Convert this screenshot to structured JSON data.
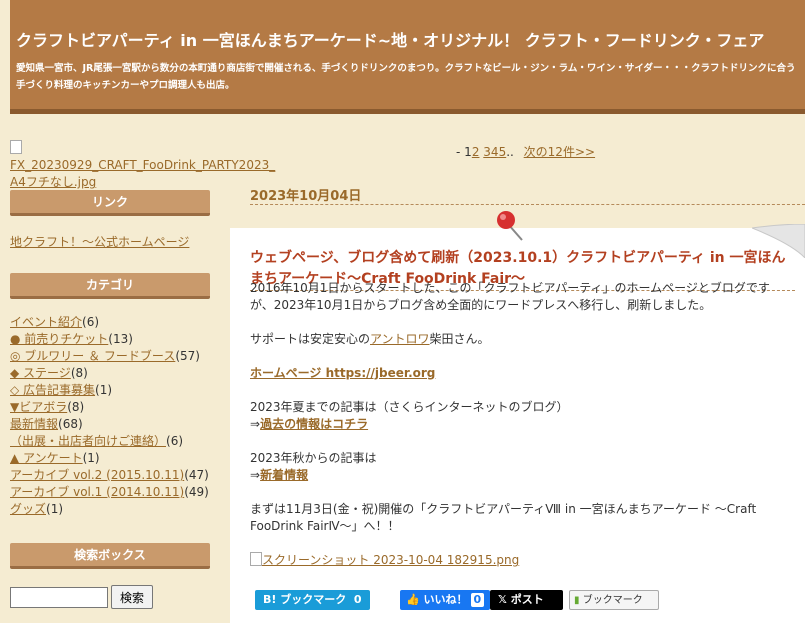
{
  "header": {
    "title": "クラフトビアパーティ in 一宮ほんまちアーケード~地・オリジナル！ クラフト・フードリンク・フェア",
    "description": "愛知県一宮市、JR尾張一宮駅から数分の本町通り商店街で開催される、手づくりドリンクのまつり。クラフトなビール・ジン・ラム・ワイン・サイダー・・・クラフトドリンクに合う手づくり料理のキッチンカーやプロ調理人も出店。"
  },
  "banner": {
    "alt": "FX_20230929_CRAFT_FooDrink_PARTY2023_A4フチなし.jpg"
  },
  "sidebar": {
    "links_heading": "リンク",
    "link_official": "地クラフト！～公式ホームページ",
    "categories_heading": "カテゴリ",
    "categories": [
      {
        "label": "イベント紹介",
        "count": "(6)"
      },
      {
        "label": "● 前売りチケット",
        "count": "(13)"
      },
      {
        "label": "◎ ブルワリー ＆ フードブース",
        "count": "(57)"
      },
      {
        "label": "◆ ステージ",
        "count": "(8)"
      },
      {
        "label": "◇ 広告記事募集",
        "count": "(1)"
      },
      {
        "label": "▼ビアボラ",
        "count": "(8)"
      },
      {
        "label": "最新情報",
        "count": "(68)"
      },
      {
        "label": "（出展・出店者向けご連絡）",
        "count": "(6)"
      },
      {
        "label": "▲ アンケート",
        "count": "(1)"
      },
      {
        "label": "アーカイブ vol.2 (2015.10.11)",
        "count": "(47)"
      },
      {
        "label": "アーカイブ vol.1 (2014.10.11)",
        "count": "(49)"
      },
      {
        "label": "グッズ",
        "count": "(1)"
      }
    ],
    "search_heading": "検索ボックス",
    "search_value": "",
    "search_button": "検索"
  },
  "pager": {
    "prefix": "-",
    "current": "1",
    "pages": [
      "2",
      "3",
      "4",
      "5"
    ],
    "ellipsis": "..",
    "next": "次の12件>>"
  },
  "post": {
    "date": "2023年10月04日",
    "title": "ウェブページ、ブログ含めて刷新（2023.10.1）クラフトビアパーティ in 一宮ほんまちアーケード～Craft FooDrink Fair～",
    "para1": "2016年10月1日からスタートした、この「クラフトビアパーティ」のホームページとブログですが、2023年10月1日からブログ含め全面的にワードプレスへ移行し、刷新しました。",
    "support_prefix": "サポートは安定安心の",
    "support_link": "アントロワ",
    "support_suffix": "柴田さん。",
    "homepage": "ホームページ https://jbeer.org",
    "old_text": "2023年夏までの記事は（さくらインターネットのブログ）",
    "old_arrow": "⇒",
    "old_link": "過去の情報はコチラ",
    "new_text": "2023年秋からの記事は",
    "new_arrow": "⇒",
    "new_link": "新着情報",
    "closing": "まずは11月3日(金・祝)開催の「クラフトビアパーティⅧ in 一宮ほんまちアーケード ～Craft FooDrink FairⅣ～」へ！！",
    "image_alt": "スクリーンショット 2023-10-04 182915.png"
  },
  "share": {
    "hatena": "B! ブックマーク",
    "hatena_count": "0",
    "fb": "いいね！",
    "fb_count": "0",
    "x": "ポスト",
    "bm": "ブックマーク"
  },
  "colors": {
    "header_bg": "#b47a45",
    "page_bg": "#f5ecd2",
    "title_red": "#b34020",
    "link_brown": "#9a6a2a"
  }
}
